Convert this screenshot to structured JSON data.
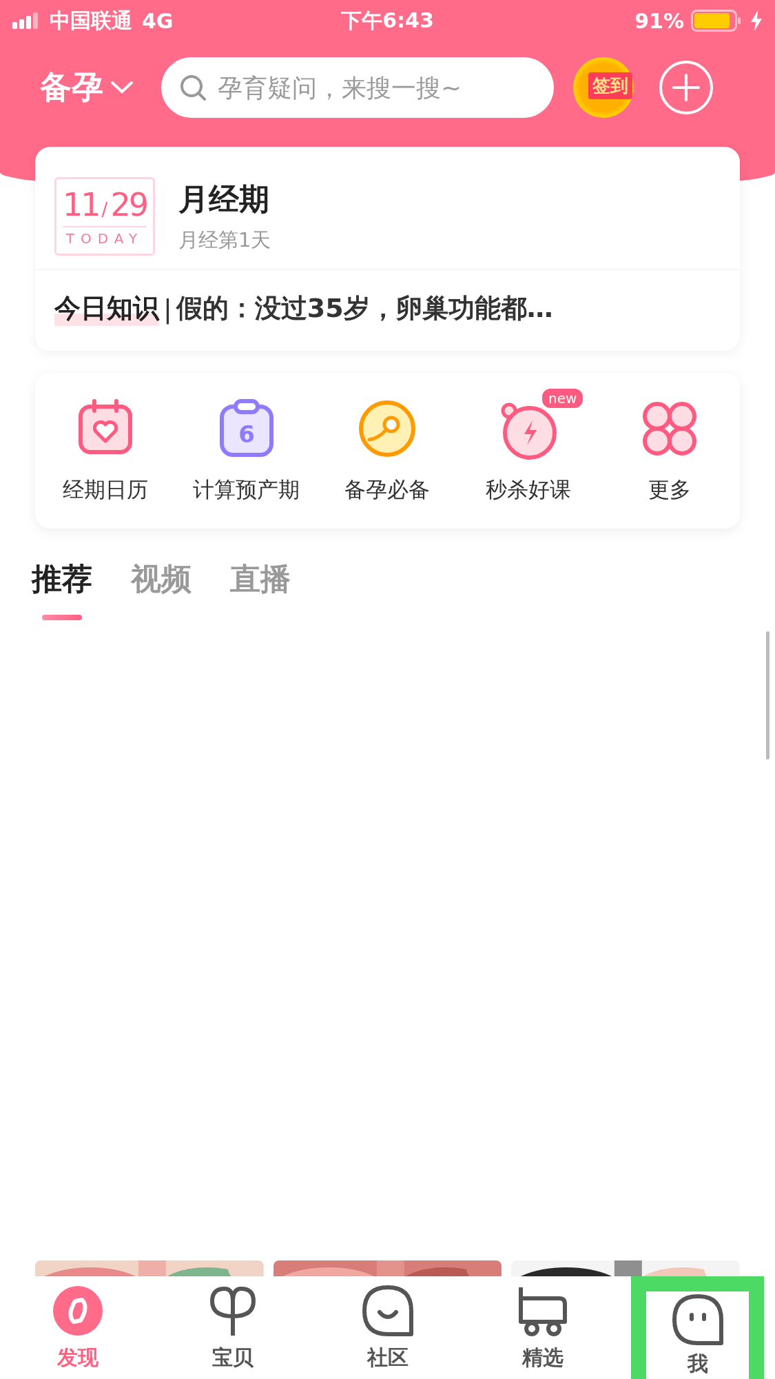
{
  "status_bar": {
    "carrier": "中国联通",
    "network": "4G",
    "time": "下午6:43",
    "battery": "91%"
  },
  "header": {
    "mode": "备孕",
    "search": {
      "placeholder": "孕育疑问，来搜一搜~"
    },
    "checkin": "签到"
  },
  "cycle_card": {
    "month": "11",
    "slash": "/",
    "day": "29",
    "today": "TODAY",
    "title": "月经期",
    "subtitle": "月经第1天",
    "knowledge_label": "今日知识",
    "separator": "|",
    "knowledge_text": "假的：没过35岁，卵巢功能都…"
  },
  "shortcuts": [
    {
      "kind": "calendar",
      "label": "经期日历"
    },
    {
      "kind": "due-date",
      "label": "计算预产期",
      "icon_label": "6"
    },
    {
      "kind": "essentials",
      "label": "备孕必备"
    },
    {
      "kind": "course",
      "label": "秒杀好课",
      "badge": "new"
    },
    {
      "kind": "more",
      "label": "更多"
    }
  ],
  "tabs": [
    {
      "label": "推荐",
      "selected": true
    },
    {
      "label": "视频",
      "selected": false
    },
    {
      "label": "直播",
      "selected": false
    }
  ],
  "bottom_nav": [
    {
      "kind": "discover",
      "label": "发现",
      "selected": true,
      "highlighted": false
    },
    {
      "kind": "baby",
      "label": "宝贝",
      "selected": false,
      "highlighted": false
    },
    {
      "kind": "community",
      "label": "社区",
      "selected": false,
      "highlighted": false
    },
    {
      "kind": "shop",
      "label": "精选",
      "selected": false,
      "highlighted": false
    },
    {
      "kind": "me",
      "label": "我",
      "selected": false,
      "highlighted": true
    }
  ]
}
